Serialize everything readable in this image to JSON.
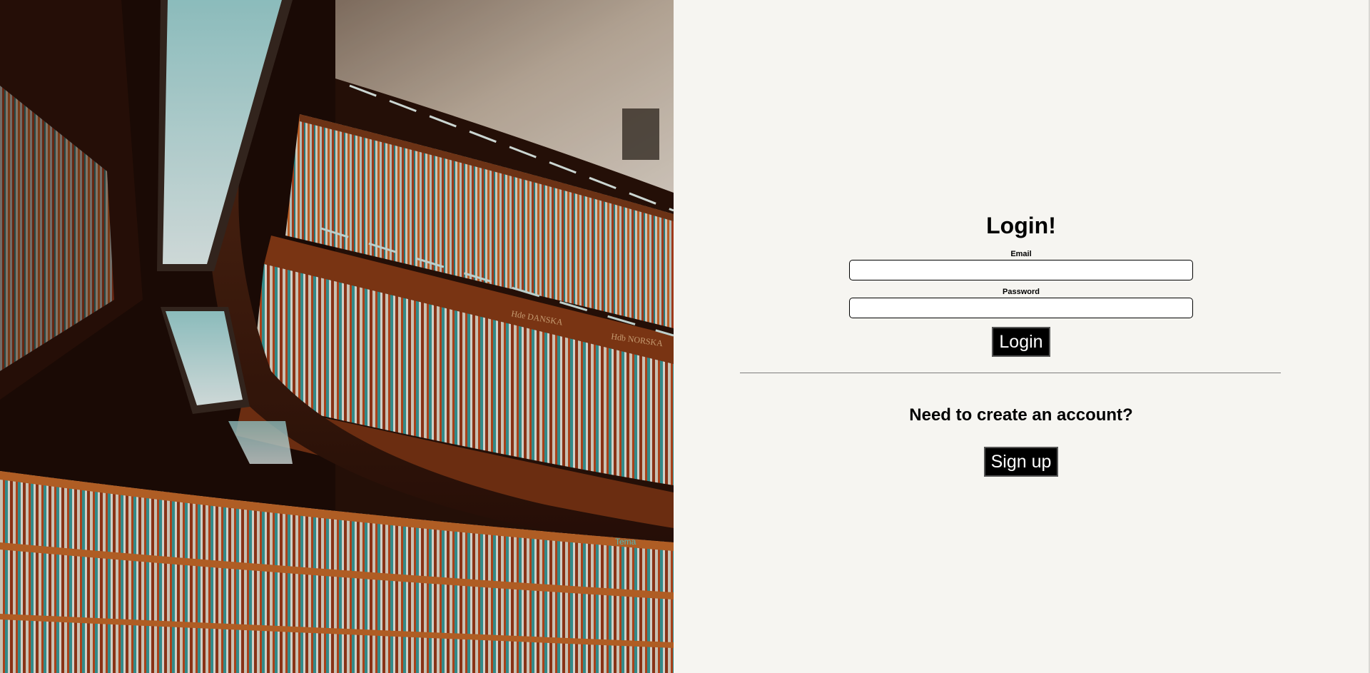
{
  "hero": {
    "image": "library-bookshelves",
    "shelf_sign_1": "Hde DANSKA",
    "shelf_sign_2": "Hdb NORSKA",
    "shelf_sign_3": "Tema"
  },
  "login": {
    "title": "Login!",
    "email_label": "Email",
    "email_value": "",
    "password_label": "Password",
    "password_value": "",
    "submit_label": "Login"
  },
  "signup": {
    "heading": "Need to create an account?",
    "button_label": "Sign up"
  },
  "colors": {
    "panel_background": "#f6f5f1",
    "button_background": "#000000",
    "button_text": "#ffffff"
  }
}
